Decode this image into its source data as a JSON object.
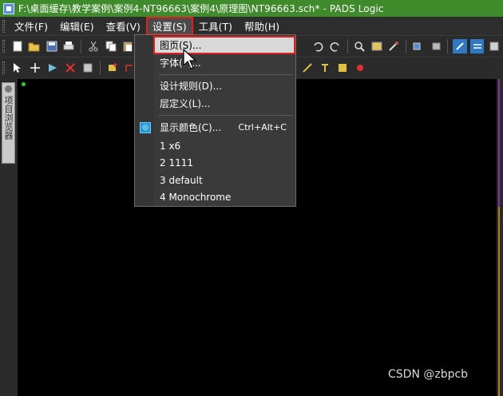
{
  "window": {
    "title": "F:\\桌面缓存\\教学案例\\案例4-NT96663\\案例4\\原理图\\NT96663.sch* - PADS Logic"
  },
  "menubar": {
    "items": [
      {
        "label": "文件(F)"
      },
      {
        "label": "编辑(E)"
      },
      {
        "label": "查看(V)"
      },
      {
        "label": "设置(S)"
      },
      {
        "label": "工具(T)"
      },
      {
        "label": "帮助(H)"
      }
    ]
  },
  "toolbar1": {
    "icons": [
      "new-icon",
      "open-icon",
      "save-icon",
      "print-icon",
      "cut-icon",
      "copy-icon",
      "paste-icon",
      "undo-icon",
      "redo-icon",
      "zoom-icon",
      "layout-icon",
      "brush-icon",
      "link-icon",
      "import-icon",
      "sync-icon",
      "compare-icon",
      "netlist-icon"
    ]
  },
  "toolbar2": {
    "icons": [
      "select-icon",
      "move-icon",
      "pointer-icon",
      "delete-icon",
      "properties-icon",
      "add-part-icon",
      "add-wire-icon"
    ]
  },
  "left_panel": {
    "tab_label": "项目浏览器"
  },
  "dropdown": {
    "items": [
      {
        "label": "图页(S)..."
      },
      {
        "label": "字体(F)..."
      },
      {
        "label": "设计规则(D)..."
      },
      {
        "label": "层定义(L)..."
      },
      {
        "label": "显示颜色(C)...",
        "shortcut": "Ctrl+Alt+C"
      },
      {
        "label": "1 x6"
      },
      {
        "label": "2 1111"
      },
      {
        "label": "3 default"
      },
      {
        "label": "4 Monochrome"
      }
    ]
  },
  "watermark": "CSDN @zbpcb",
  "colors": {
    "titlebar": "#3f8a2b",
    "highlight_border": "#e0201e",
    "canvas": "#000000",
    "menu_bg": "#3a3a3a"
  }
}
